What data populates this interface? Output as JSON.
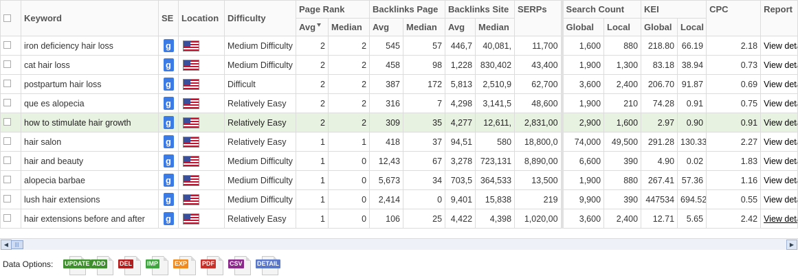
{
  "columns": {
    "keyword": "Keyword",
    "se": "SE",
    "location": "Location",
    "difficulty": "Difficulty",
    "page_rank": "Page Rank",
    "backlinks_page": "Backlinks Page",
    "backlinks_site": "Backlinks Site",
    "serps": "SERPs",
    "search_count": "Search Count",
    "kei": "KEI",
    "cpc": "CPC",
    "report": "Report",
    "avg": "Avg",
    "median": "Median",
    "global": "Global",
    "local": "Local"
  },
  "se_glyph": "g",
  "rows": [
    {
      "keyword": "iron deficiency hair loss",
      "difficulty": "Medium Difficulty",
      "pr_avg": "2",
      "pr_med": "2",
      "bp_avg": "545",
      "bp_med": "57",
      "bs_avg": "446,7",
      "bs_med": "40,081,",
      "serps": "11,700",
      "sc_global": "1,600",
      "sc_local": "880",
      "kei_global": "218.80",
      "kei_local": "66.19",
      "cpc": "2.18",
      "report": "View details"
    },
    {
      "keyword": "cat hair loss",
      "difficulty": "Medium Difficulty",
      "pr_avg": "2",
      "pr_med": "2",
      "bp_avg": "458",
      "bp_med": "98",
      "bs_avg": "1,228",
      "bs_med": "830,402",
      "serps": "43,400",
      "sc_global": "1,900",
      "sc_local": "1,300",
      "kei_global": "83.18",
      "kei_local": "38.94",
      "cpc": "0.73",
      "report": "View details"
    },
    {
      "keyword": "postpartum hair loss",
      "difficulty": "Difficult",
      "pr_avg": "2",
      "pr_med": "2",
      "bp_avg": "387",
      "bp_med": "172",
      "bs_avg": "5,813",
      "bs_med": "2,510,9",
      "serps": "62,700",
      "sc_global": "3,600",
      "sc_local": "2,400",
      "kei_global": "206.70",
      "kei_local": "91.87",
      "cpc": "0.69",
      "report": "View details"
    },
    {
      "keyword": "que es alopecia",
      "difficulty": "Relatively Easy",
      "pr_avg": "2",
      "pr_med": "2",
      "bp_avg": "316",
      "bp_med": "7",
      "bs_avg": "4,298",
      "bs_med": "3,141,5",
      "serps": "48,600",
      "sc_global": "1,900",
      "sc_local": "210",
      "kei_global": "74.28",
      "kei_local": "0.91",
      "cpc": "0.75",
      "report": "View details"
    },
    {
      "keyword": "how to stimulate hair growth",
      "difficulty": "Relatively Easy",
      "pr_avg": "2",
      "pr_med": "2",
      "bp_avg": "309",
      "bp_med": "35",
      "bs_avg": "4,277",
      "bs_med": "12,611,",
      "serps": "2,831,00",
      "sc_global": "2,900",
      "sc_local": "1,600",
      "kei_global": "2.97",
      "kei_local": "0.90",
      "cpc": "0.91",
      "report": "View details"
    },
    {
      "keyword": "hair salon",
      "difficulty": "Relatively Easy",
      "pr_avg": "1",
      "pr_med": "1",
      "bp_avg": "418",
      "bp_med": "37",
      "bs_avg": "94,51",
      "bs_med": "580",
      "serps": "18,800,0",
      "sc_global": "74,000",
      "sc_local": "49,500",
      "kei_global": "291.28",
      "kei_local": "130.33",
      "cpc": "2.27",
      "report": "View details"
    },
    {
      "keyword": "hair and beauty",
      "difficulty": "Medium Difficulty",
      "pr_avg": "1",
      "pr_med": "0",
      "bp_avg": "12,43",
      "bp_med": "67",
      "bs_avg": "3,278",
      "bs_med": "723,131",
      "serps": "8,890,00",
      "sc_global": "6,600",
      "sc_local": "390",
      "kei_global": "4.90",
      "kei_local": "0.02",
      "cpc": "1.83",
      "report": "View details"
    },
    {
      "keyword": "alopecia barbae",
      "difficulty": "Medium Difficulty",
      "pr_avg": "1",
      "pr_med": "0",
      "bp_avg": "5,673",
      "bp_med": "34",
      "bs_avg": "703,5",
      "bs_med": "364,533",
      "serps": "13,500",
      "sc_global": "1,900",
      "sc_local": "880",
      "kei_global": "267.41",
      "kei_local": "57.36",
      "cpc": "1.16",
      "report": "View details"
    },
    {
      "keyword": "lush hair extensions",
      "difficulty": "Medium Difficulty",
      "pr_avg": "1",
      "pr_med": "0",
      "bp_avg": "2,414",
      "bp_med": "0",
      "bs_avg": "9,401",
      "bs_med": "15,838",
      "serps": "219",
      "sc_global": "9,900",
      "sc_local": "390",
      "kei_global": "447534",
      "kei_local": "694.52",
      "cpc": "0.55",
      "report": "View details"
    },
    {
      "keyword": "hair extensions before and after",
      "difficulty": "Relatively Easy",
      "pr_avg": "1",
      "pr_med": "0",
      "bp_avg": "106",
      "bp_med": "25",
      "bs_avg": "4,422",
      "bs_med": "4,398",
      "serps": "1,020,00",
      "sc_global": "3,600",
      "sc_local": "2,400",
      "kei_global": "12.71",
      "kei_local": "5.65",
      "cpc": "2.42",
      "report": "View details"
    }
  ],
  "footer": {
    "label": "Data Options:",
    "buttons": [
      {
        "label": "UPDATE",
        "color": "#3f8f2e"
      },
      {
        "label": "ADD",
        "color": "#3f8f2e"
      },
      {
        "label": "DEL",
        "color": "#b21e1e"
      },
      {
        "label": "IMP",
        "color": "#3fa53f"
      },
      {
        "label": "EXP",
        "color": "#f08a1c"
      },
      {
        "label": "PDF",
        "color": "#c8302a"
      },
      {
        "label": "CSV",
        "color": "#8a2a8a"
      },
      {
        "label": "DETAIL",
        "color": "#5b78c8"
      }
    ]
  }
}
